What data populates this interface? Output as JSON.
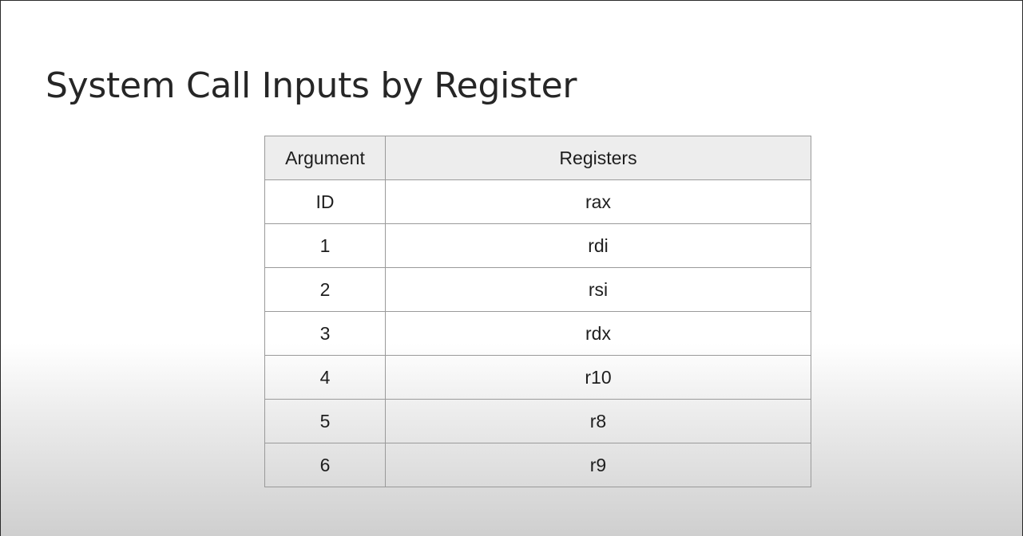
{
  "slide": {
    "title": "System Call Inputs by Register"
  },
  "table": {
    "headers": [
      "Argument",
      "Registers"
    ],
    "rows": [
      [
        "ID",
        "rax"
      ],
      [
        "1",
        "rdi"
      ],
      [
        "2",
        "rsi"
      ],
      [
        "3",
        "rdx"
      ],
      [
        "4",
        "r10"
      ],
      [
        "5",
        "r8"
      ],
      [
        "6",
        "r9"
      ]
    ]
  }
}
